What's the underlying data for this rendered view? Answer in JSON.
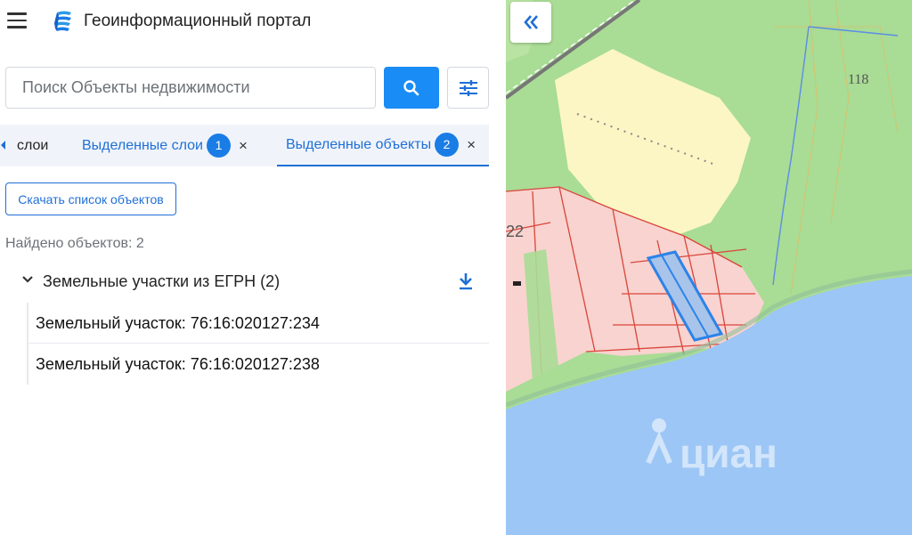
{
  "header": {
    "title": "Геоинформационный портал"
  },
  "search": {
    "placeholder": "Поиск Объекты недвижимости"
  },
  "tabs": [
    {
      "label": "слои"
    },
    {
      "label": "Выделенные слои",
      "badge": "1",
      "close": "×"
    },
    {
      "label": "Выделенные объекты",
      "badge": "2",
      "close": "×"
    }
  ],
  "results": {
    "download_label": "Скачать список объектов",
    "found_text": "Найдено объектов: 2",
    "group_label": "Земельные участки из ЕГРН (2)",
    "items": [
      {
        "label": "Земельный участок: 76:16:020127:234"
      },
      {
        "label": "Земельный участок: 76:16:020127:238"
      }
    ]
  },
  "map": {
    "labels": {
      "number_right": "118",
      "number_left": "22"
    },
    "watermark": "циан",
    "colors": {
      "water": "#9cc6f5",
      "forest": "#a9dc95",
      "field": "#fbf6c4",
      "parcel": "#f8d3cf",
      "parcel_border": "#d9453a",
      "selection": "#2c83e8"
    }
  },
  "colors": {
    "accent": "#1a8cf5",
    "link": "#1f6fd6"
  }
}
